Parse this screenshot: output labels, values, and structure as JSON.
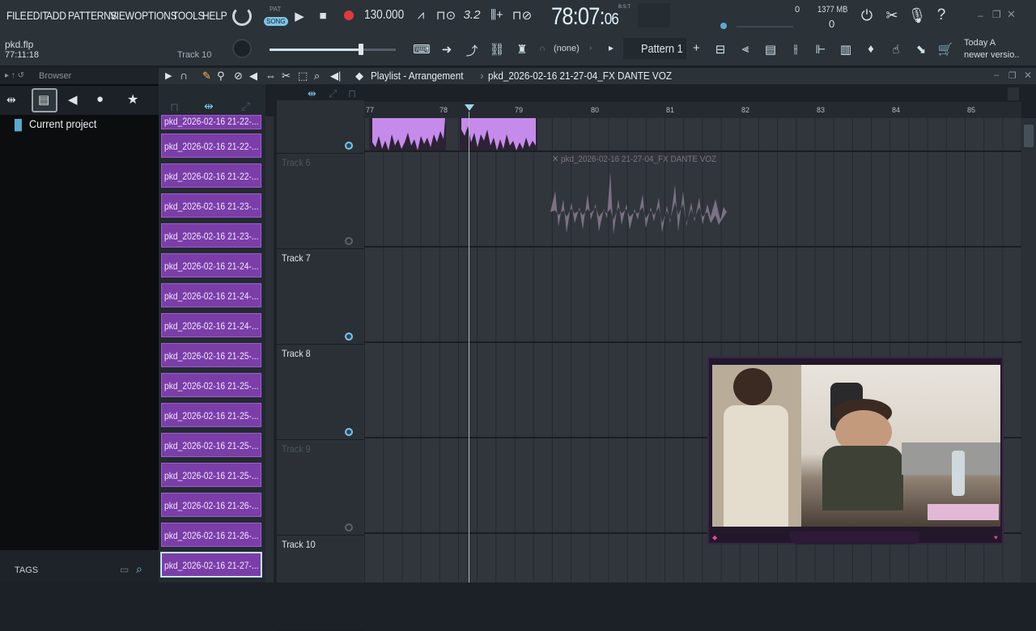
{
  "menu": [
    "FILE",
    "EDIT",
    "ADD",
    "PATTERNS",
    "VIEW",
    "OPTIONS",
    "TOOLS",
    "HELP"
  ],
  "transport": {
    "pat_label": "PAT",
    "song_label": "SONG",
    "tempo": "130.000"
  },
  "clock": {
    "main": "78:07:",
    "sub": "06",
    "unit": "B:S:T"
  },
  "cpu": {
    "mem": "1377 MB",
    "voices": "0",
    "cpu_val": "0"
  },
  "project": {
    "filename": "pkd.flp",
    "time": "77:11:18",
    "track_hint": "Track 10"
  },
  "pattern": {
    "none_label": "(none)",
    "name": "Pattern 1",
    "add": "+"
  },
  "news": {
    "line1": "Today  A",
    "line2": "newer versio.."
  },
  "browser": {
    "title": "Browser",
    "current": "Current project",
    "tags": "TAGS"
  },
  "playlist": {
    "title": "Playlist - Arrangement",
    "arrow": "›",
    "file": "pkd_2026-02-16 21-27-04_FX DANTE VOZ"
  },
  "ruler": [
    "77",
    "78",
    "79",
    "80",
    "81",
    "82",
    "83",
    "84",
    "85"
  ],
  "audio_clip": {
    "label": "pkd_2026-02-16 21-27-04_FX DANTE VOZ"
  },
  "clips": [
    "pkd_2026-02-16 21-22-...",
    "pkd_2026-02-16 21-22-...",
    "pkd_2026-02-16 21-23-...",
    "pkd_2026-02-16 21-23-...",
    "pkd_2026-02-16 21-24-...",
    "pkd_2026-02-16 21-24-...",
    "pkd_2026-02-16 21-24-...",
    "pkd_2026-02-16 21-25-...",
    "pkd_2026-02-16 21-25-...",
    "pkd_2026-02-16 21-25-...",
    "pkd_2026-02-16 21-25-...",
    "pkd_2026-02-16 21-25-...",
    "pkd_2026-02-16 21-26-...",
    "pkd_2026-02-16 21-26-...",
    "pkd_2026-02-16 21-27-..."
  ],
  "tracks": [
    {
      "name": "Track 6",
      "dim": true
    },
    {
      "name": "Track 7",
      "dim": false
    },
    {
      "name": "Track 8",
      "dim": false
    },
    {
      "name": "Track 9",
      "dim": true
    },
    {
      "name": "Track 10",
      "dim": false
    }
  ],
  "colors": {
    "clip_purple": "#7b3ea9",
    "wave_purple": "#c58bea",
    "accent_blue": "#7ec4e8"
  }
}
